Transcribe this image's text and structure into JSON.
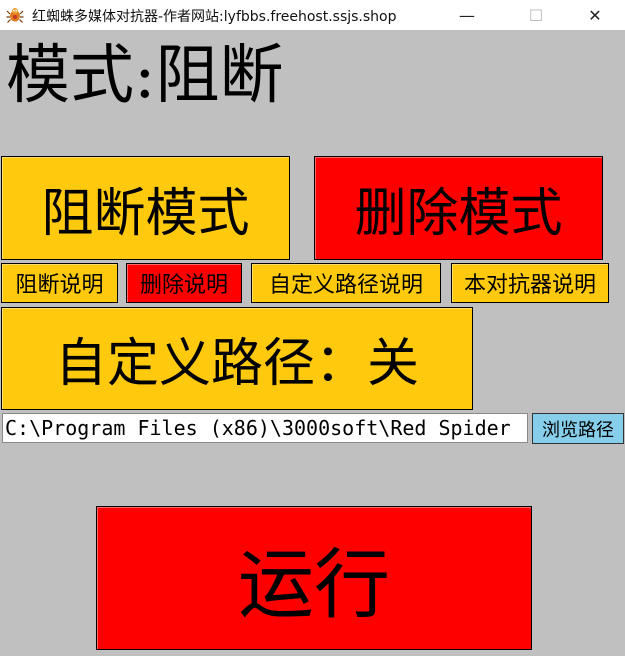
{
  "window": {
    "title": "红蜘蛛多媒体对抗器-作者网站:lyfbbs.freehost.ssjs.shop",
    "minimize_glyph": "—",
    "maximize_glyph": "☐",
    "close_glyph": "✕"
  },
  "mode_label": "模式:阻断",
  "buttons": {
    "block_mode": "阻断模式",
    "delete_mode": "删除模式",
    "block_help": "阻断说明",
    "delete_help": "删除说明",
    "custom_path_help": "自定义路径说明",
    "about_help": "本对抗器说明",
    "custom_path_toggle": "自定义路径：关",
    "browse": "浏览路径",
    "run": "运行"
  },
  "path_input": {
    "value": "C:\\Program Files (x86)\\3000soft\\Red Spider"
  },
  "colors": {
    "background": "#c0c0c0",
    "yellow": "#ffc90e",
    "red": "#ff0000",
    "browse_blue": "#87ceeb"
  },
  "icons": {
    "app_icon": "spider-icon"
  }
}
